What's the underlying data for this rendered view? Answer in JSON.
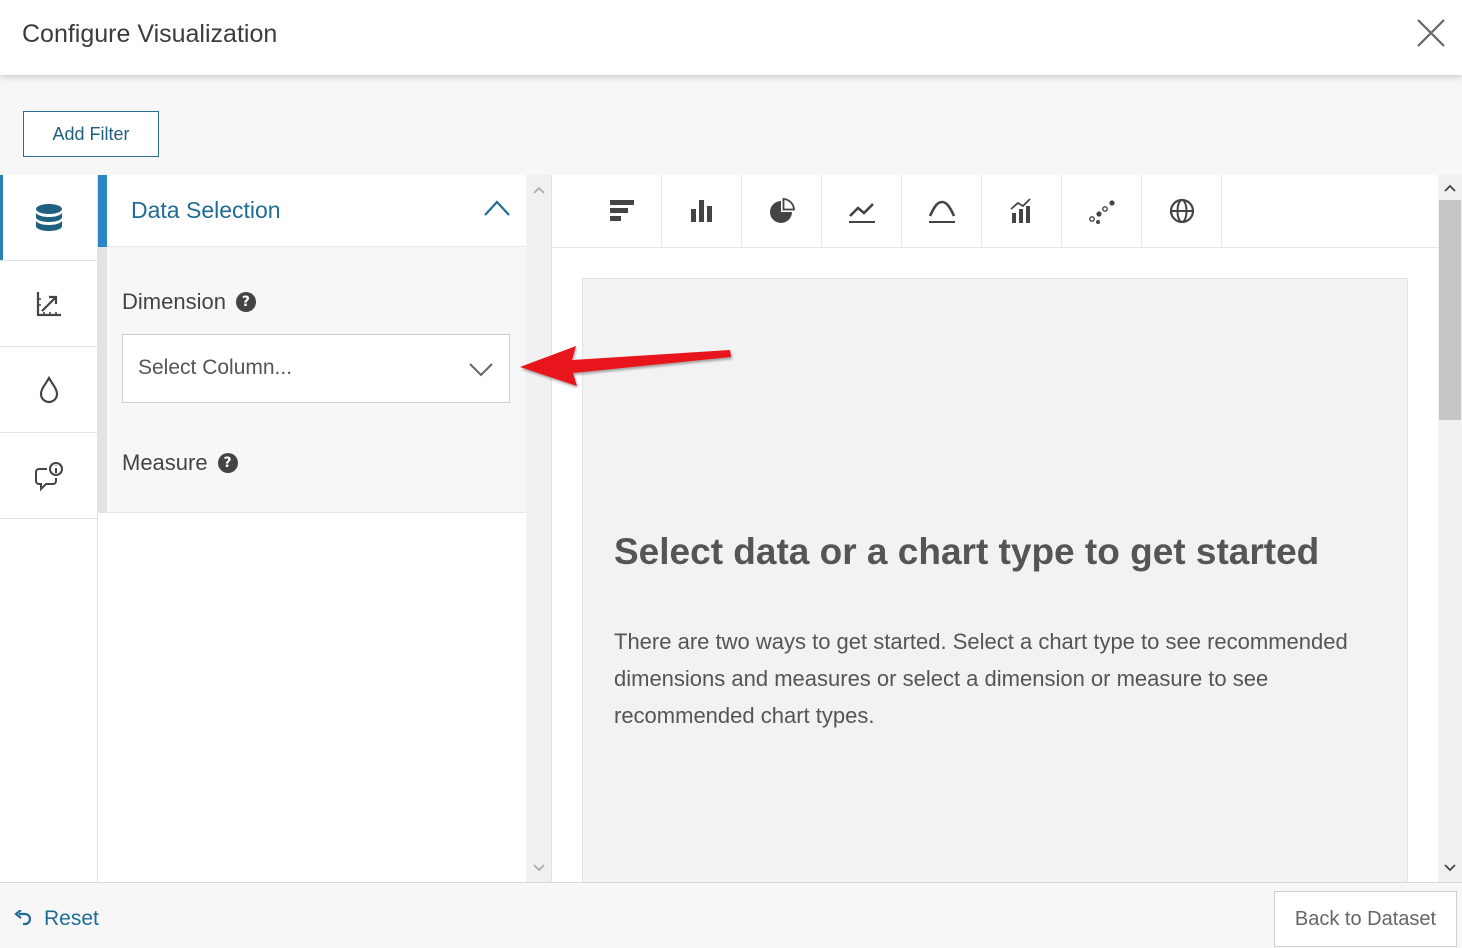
{
  "header": {
    "title": "Configure Visualization",
    "close_icon": "close-icon"
  },
  "filter_bar": {
    "add_filter_label": "Add Filter"
  },
  "rail": {
    "items": [
      {
        "icon": "database-icon",
        "active": true
      },
      {
        "icon": "axis-chart-icon",
        "active": false
      },
      {
        "icon": "droplet-icon",
        "active": false
      },
      {
        "icon": "info-bubble-icon",
        "active": false
      }
    ]
  },
  "panel": {
    "title": "Data Selection",
    "dimension_label": "Dimension",
    "dimension_select_placeholder": "Select Column...",
    "measure_label": "Measure",
    "help_glyph": "?"
  },
  "chart_toolbar": {
    "types": [
      "horizontal-bar-chart-icon",
      "column-chart-icon",
      "pie-chart-icon",
      "line-chart-icon",
      "area-chart-icon",
      "combo-chart-icon",
      "scatter-plot-icon",
      "map-globe-icon"
    ]
  },
  "canvas": {
    "title": "Select data or a chart type to get started",
    "description": "There are two ways to get started. Select a chart type to see recommended dimensions and measures or select a dimension or measure to see recommended chart types."
  },
  "footer": {
    "reset_label": "Reset",
    "back_label": "Back to Dataset"
  },
  "colors": {
    "accent": "#2a87c3",
    "link": "#1f6c97",
    "annotation_arrow": "#e8141b"
  }
}
